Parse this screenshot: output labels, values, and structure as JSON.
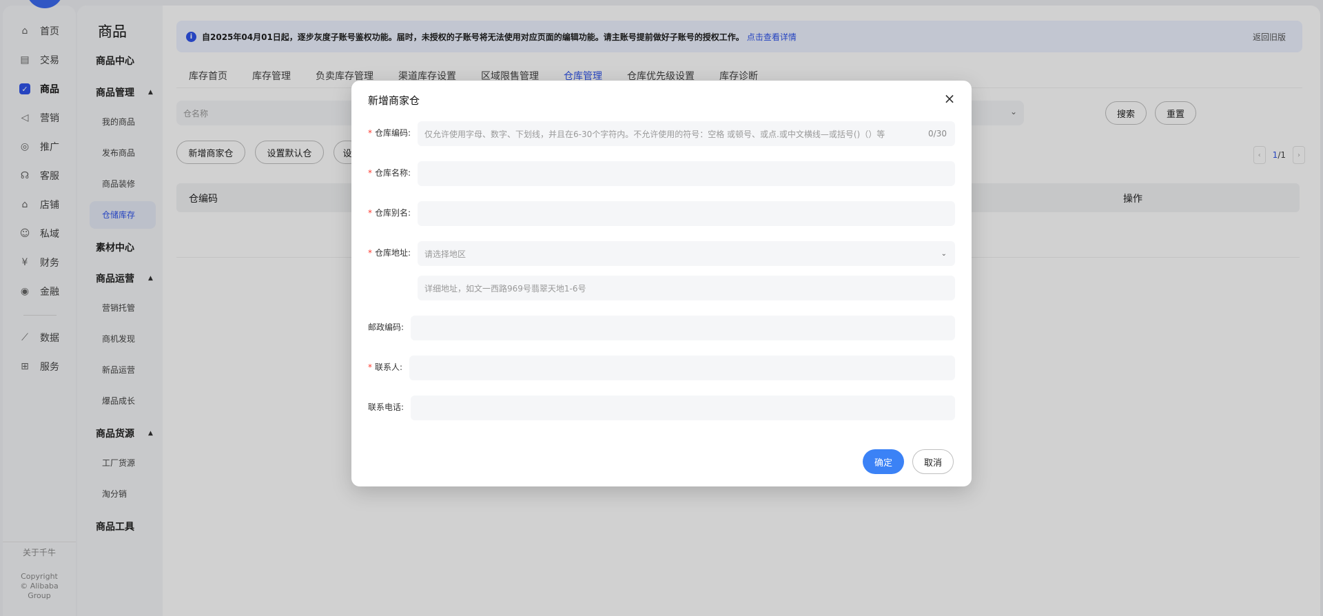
{
  "left_nav": {
    "items": [
      {
        "label": "首页",
        "icon": "home-icon",
        "glyph": "⌂"
      },
      {
        "label": "交易",
        "icon": "clipboard-icon",
        "glyph": "▤"
      },
      {
        "label": "商品",
        "icon": "product-icon",
        "glyph": "✓"
      },
      {
        "label": "营销",
        "icon": "megaphone-icon",
        "glyph": "◁"
      },
      {
        "label": "推广",
        "icon": "promotion-icon",
        "glyph": "◎"
      },
      {
        "label": "客服",
        "icon": "headset-icon",
        "glyph": "☊"
      },
      {
        "label": "店铺",
        "icon": "store-icon",
        "glyph": "⌂"
      },
      {
        "label": "私域",
        "icon": "community-icon",
        "glyph": "☺"
      },
      {
        "label": "财务",
        "icon": "finance-icon",
        "glyph": "¥"
      },
      {
        "label": "金融",
        "icon": "target-icon",
        "glyph": "◉"
      },
      {
        "label": "数据",
        "icon": "chart-icon",
        "glyph": "⟋"
      },
      {
        "label": "服务",
        "icon": "grid-icon",
        "glyph": "⊞"
      }
    ],
    "about": "关于千牛",
    "copyright": [
      "Copyright",
      "© Alibaba",
      "Group"
    ]
  },
  "sub_nav": {
    "title": "商品",
    "product_center": "商品中心",
    "product_mgmt": "商品管理",
    "my_products": "我的商品",
    "publish": "发布商品",
    "decorate": "商品装修",
    "warehouse": "仓储库存",
    "material_center": "素材中心",
    "product_ops": "商品运营",
    "marketing_trust": "营销托管",
    "opportunity": "商机发现",
    "new_ops": "新品运营",
    "hot_growth": "爆品成长",
    "sourcing": "商品货源",
    "factory": "工厂货源",
    "taofenxiao": "淘分销",
    "tools": "商品工具"
  },
  "notice": {
    "text": "自2025年04月01日起，逐步灰度子账号鉴权功能。届时，未授权的子账号将无法使用对应页面的编辑功能。请主账号提前做好子账号的授权工作。",
    "link": "点击查看详情",
    "back_old": "返回旧版"
  },
  "tabs": [
    "库存首页",
    "库存管理",
    "负卖库存管理",
    "渠道库存设置",
    "区域限售管理",
    "仓库管理",
    "仓库优先级设置",
    "库存诊断"
  ],
  "filter": {
    "placeholder": "仓名称",
    "search": "搜索",
    "reset": "重置"
  },
  "actions": {
    "add": "新增商家仓",
    "set_default": "设置默认仓",
    "partial": "设"
  },
  "pager": {
    "current": "1",
    "total": "/1"
  },
  "table": {
    "col_code": "仓编码",
    "col_ops": "操作"
  },
  "modal": {
    "title": "新增商家仓",
    "code_label": "仓库编码:",
    "code_placeholder": "仅允许使用字母、数字、下划线，并且在6-30个字符内。不允许使用的符号：空格 或顿号、或点.或中文横线—或括号()（）等",
    "code_counter": "0/30",
    "name_label": "仓库名称:",
    "alias_label": "仓库别名:",
    "address_label": "仓库地址:",
    "region_placeholder": "请选择地区",
    "detail_placeholder": "详细地址，如文一西路969号翡翠天地1-6号",
    "postal_label": "邮政编码:",
    "contact_label": "联系人:",
    "phone_label": "联系电话:",
    "ok": "确定",
    "cancel": "取消"
  }
}
